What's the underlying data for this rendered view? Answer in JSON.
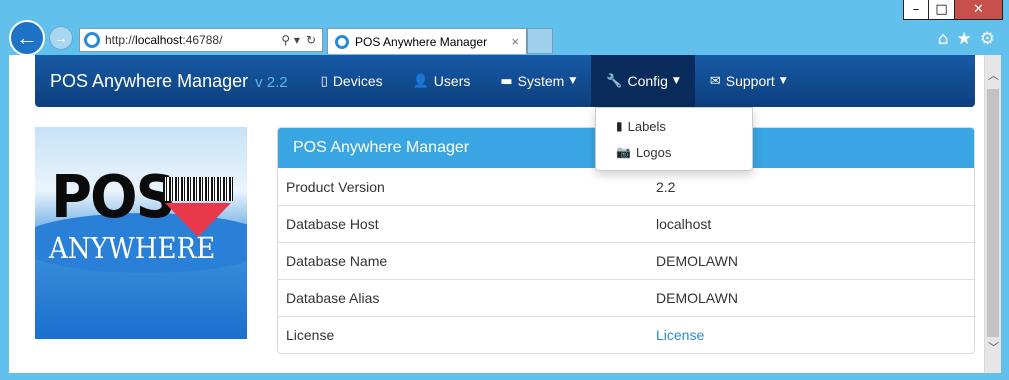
{
  "browser": {
    "url_prefix": "http://",
    "url_host": "localhost",
    "url_suffix": ":46788/",
    "tab_title": "POS Anywhere Manager",
    "tab_close": "×",
    "window_controls": [
      "–",
      "□",
      "✕"
    ],
    "tools": [
      "⌂",
      "★",
      "⚙"
    ]
  },
  "navbar": {
    "brand": "POS Anywhere Manager",
    "version": "v 2.2",
    "items": [
      {
        "label": "Devices",
        "icon": "mobile-icon",
        "glyph": "▯"
      },
      {
        "label": "Users",
        "icon": "user-icon",
        "glyph": "👤"
      },
      {
        "label": "System",
        "icon": "hdd-icon",
        "glyph": "▬",
        "caret": "▼"
      },
      {
        "label": "Config",
        "icon": "wrench-icon",
        "glyph": "🔧",
        "caret": "▼"
      },
      {
        "label": "Support",
        "icon": "envelope-icon",
        "glyph": "✉",
        "caret": "▼"
      }
    ],
    "active": "Config"
  },
  "config_dropdown": [
    {
      "label": "Labels",
      "icon": "book-icon",
      "glyph": "▮"
    },
    {
      "label": "Logos",
      "icon": "camera-icon",
      "glyph": "📷"
    }
  ],
  "logo": {
    "line1": "POS",
    "line2": "ANYWHERE"
  },
  "panel": {
    "title": "POS Anywhere Manager",
    "rows": [
      {
        "key": "Product Version",
        "value": "2.2"
      },
      {
        "key": "Database Host",
        "value": "localhost"
      },
      {
        "key": "Database Name",
        "value": "DEMOLAWN"
      },
      {
        "key": "Database Alias",
        "value": "DEMOLAWN"
      },
      {
        "key": "License",
        "value": "License"
      }
    ]
  },
  "colors": {
    "navbar": "#0d3f7d",
    "version": "#5db6f0",
    "panel_header": "#3aa5e3",
    "link": "#2a8bd1",
    "window_frame": "#61c0ec"
  }
}
